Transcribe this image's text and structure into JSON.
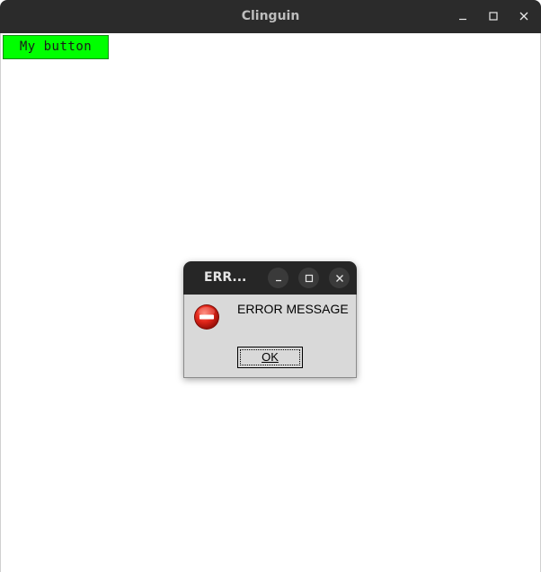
{
  "window": {
    "title": "Clinguin",
    "controls": {
      "minimize": "minimize-icon",
      "maximize": "maximize-icon",
      "close": "close-icon"
    }
  },
  "main": {
    "my_button_label": "My button",
    "my_button_color": "#00ff00"
  },
  "dialog": {
    "title": "ERR...",
    "message": "ERROR MESSAGE",
    "ok_label": "OK",
    "icon": "error-stop-icon",
    "icon_color": "#d62b1f",
    "controls": {
      "minimize": "minimize-icon",
      "maximize": "maximize-icon",
      "close": "close-icon"
    }
  }
}
